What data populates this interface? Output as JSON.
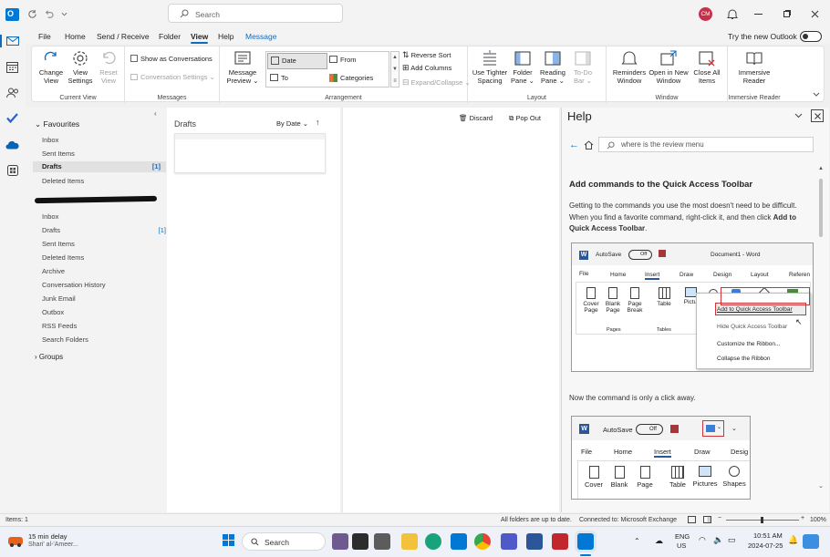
{
  "titlebar": {
    "search_placeholder": "Search",
    "avatar_initials": "CM"
  },
  "menu": {
    "tabs": [
      "File",
      "Home",
      "Send / Receive",
      "Folder",
      "View",
      "Help",
      "Message"
    ],
    "active_tab": "View",
    "try_new_outlook": "Try the new Outlook"
  },
  "ribbon": {
    "change_view": "Change View",
    "view_settings": "View Settings",
    "reset_view": "Reset View",
    "current_view_label": "Current View",
    "show_as_conversations": "Show as Conversations",
    "conversation_settings": "Conversation Settings",
    "messages_label": "Messages",
    "message_preview": "Message Preview",
    "date": "Date",
    "from": "From",
    "to": "To",
    "categories": "Categories",
    "reverse_sort": "Reverse Sort",
    "add_columns": "Add Columns",
    "expand_collapse": "Expand/Collapse",
    "arrangement_label": "Arrangement",
    "use_tighter_spacing": "Use Tighter Spacing",
    "folder_pane": "Folder Pane",
    "reading_pane": "Reading Pane",
    "todo_bar": "To-Do Bar",
    "layout_label": "Layout",
    "reminders_window": "Reminders Window",
    "open_in_new_window": "Open in New Window",
    "close_all_items": "Close All Items",
    "window_label": "Window",
    "immersive_reader": "Immersive Reader",
    "immersive_reader_label": "Immersive Reader"
  },
  "folders": {
    "favourites": "Favourites",
    "fav_items": [
      {
        "label": "Inbox",
        "badge": ""
      },
      {
        "label": "Sent Items",
        "badge": ""
      },
      {
        "label": "Drafts",
        "badge": "[1]"
      },
      {
        "label": "Deleted Items",
        "badge": ""
      }
    ],
    "account_items": [
      {
        "label": "Inbox",
        "badge": ""
      },
      {
        "label": "Drafts",
        "badge": "[1]"
      },
      {
        "label": "Sent Items",
        "badge": ""
      },
      {
        "label": "Deleted Items",
        "badge": ""
      },
      {
        "label": "Archive",
        "badge": ""
      },
      {
        "label": "Conversation History",
        "badge": ""
      },
      {
        "label": "Junk Email",
        "badge": ""
      },
      {
        "label": "Outbox",
        "badge": ""
      },
      {
        "label": "RSS Feeds",
        "badge": ""
      },
      {
        "label": "Search Folders",
        "badge": ""
      }
    ],
    "groups": "Groups"
  },
  "message_list": {
    "folder_title": "Drafts",
    "sort_label": "By Date"
  },
  "reading": {
    "discard": "Discard",
    "pop_out": "Pop Out"
  },
  "help": {
    "title": "Help",
    "search_value": "where is the review menu",
    "heading": "Add commands to the Quick Access Toolbar",
    "body": "Getting to the commands you use the most doesn't need to be difficult. When you find a favorite command, right-click it, and then click ",
    "body_bold": "Add to Quick Access Toolbar",
    "body_end": ".",
    "caption2": "Now the command is only a click away.",
    "shot1": {
      "autosave": "AutoSave",
      "off": "Off",
      "doc_title": "Document1 - Word",
      "tabs": [
        "File",
        "Home",
        "Insert",
        "Draw",
        "Design",
        "Layout",
        "Referen"
      ],
      "btns": [
        "Cover Page",
        "Blank Page",
        "Page Break",
        "Table",
        "Pictu"
      ],
      "grp_pages": "Pages",
      "grp_tables": "Tables",
      "ctx": [
        "Add to Quick Access Toolbar",
        "Hide Quick Access Toolbar",
        "Customize the Ribbon...",
        "Collapse the Ribbon"
      ]
    },
    "shot2": {
      "autosave": "AutoSave",
      "off": "Off",
      "tabs": [
        "File",
        "Home",
        "Insert",
        "Draw",
        "Desig"
      ],
      "btns": [
        "Cover",
        "Blank",
        "Page",
        "Table",
        "Pictures",
        "Shapes"
      ]
    }
  },
  "status": {
    "items": "Items: 1",
    "sync": "All folders are up to date.",
    "connection": "Connected to: Microsoft Exchange",
    "zoom": "100%"
  },
  "taskbar": {
    "weather_title": "15 min delay",
    "weather_sub": "Shari' al-'Ameer...",
    "search": "Search",
    "lang1": "ENG",
    "lang2": "US",
    "time": "10:51 AM",
    "date": "2024-07-25"
  },
  "colors": {
    "accent": "#0f6cbd",
    "outlook_blue": "#0078d4",
    "avatar_red": "#c4314b",
    "highlight_red": "#d13438"
  }
}
